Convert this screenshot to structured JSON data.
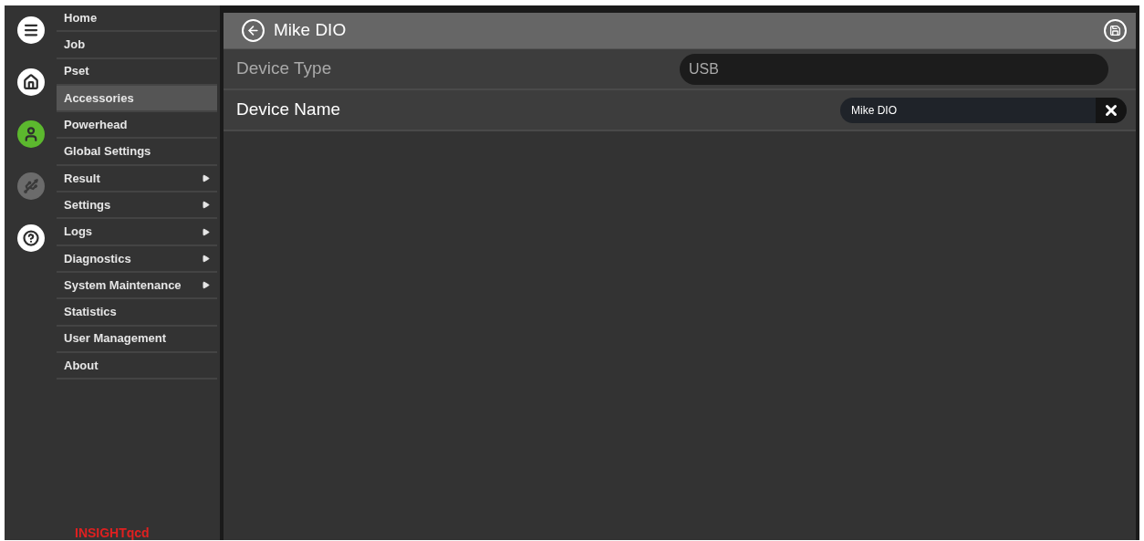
{
  "rail": [
    {
      "kind": "menu",
      "selected": false,
      "disabled": false
    },
    {
      "kind": "home",
      "selected": false,
      "disabled": false
    },
    {
      "kind": "user",
      "selected": true,
      "disabled": false
    },
    {
      "kind": "usb",
      "selected": false,
      "disabled": true
    },
    {
      "kind": "help",
      "selected": false,
      "disabled": false
    }
  ],
  "menu": [
    {
      "label": "Home",
      "selected": false,
      "submenu": false
    },
    {
      "label": "Job",
      "selected": false,
      "submenu": false
    },
    {
      "label": "Pset",
      "selected": false,
      "submenu": false
    },
    {
      "label": "Accessories",
      "selected": true,
      "submenu": false
    },
    {
      "label": "Powerhead",
      "selected": false,
      "submenu": false
    },
    {
      "label": "Global Settings",
      "selected": false,
      "submenu": false
    },
    {
      "label": "Result",
      "selected": false,
      "submenu": true
    },
    {
      "label": "Settings",
      "selected": false,
      "submenu": true
    },
    {
      "label": "Logs",
      "selected": false,
      "submenu": true
    },
    {
      "label": "Diagnostics",
      "selected": false,
      "submenu": true
    },
    {
      "label": "System Maintenance",
      "selected": false,
      "submenu": true
    },
    {
      "label": "Statistics",
      "selected": false,
      "submenu": false
    },
    {
      "label": "User Management",
      "selected": false,
      "submenu": false
    },
    {
      "label": "About",
      "selected": false,
      "submenu": false
    }
  ],
  "logo": "INSIGHTqcd",
  "header": {
    "title": "Mike DIO"
  },
  "fields": [
    {
      "label": "Device Type",
      "kind": "readonly",
      "value": "USB",
      "disabled": true
    },
    {
      "label": "Device Name",
      "kind": "text",
      "value": "Mike DIO",
      "disabled": false
    }
  ]
}
